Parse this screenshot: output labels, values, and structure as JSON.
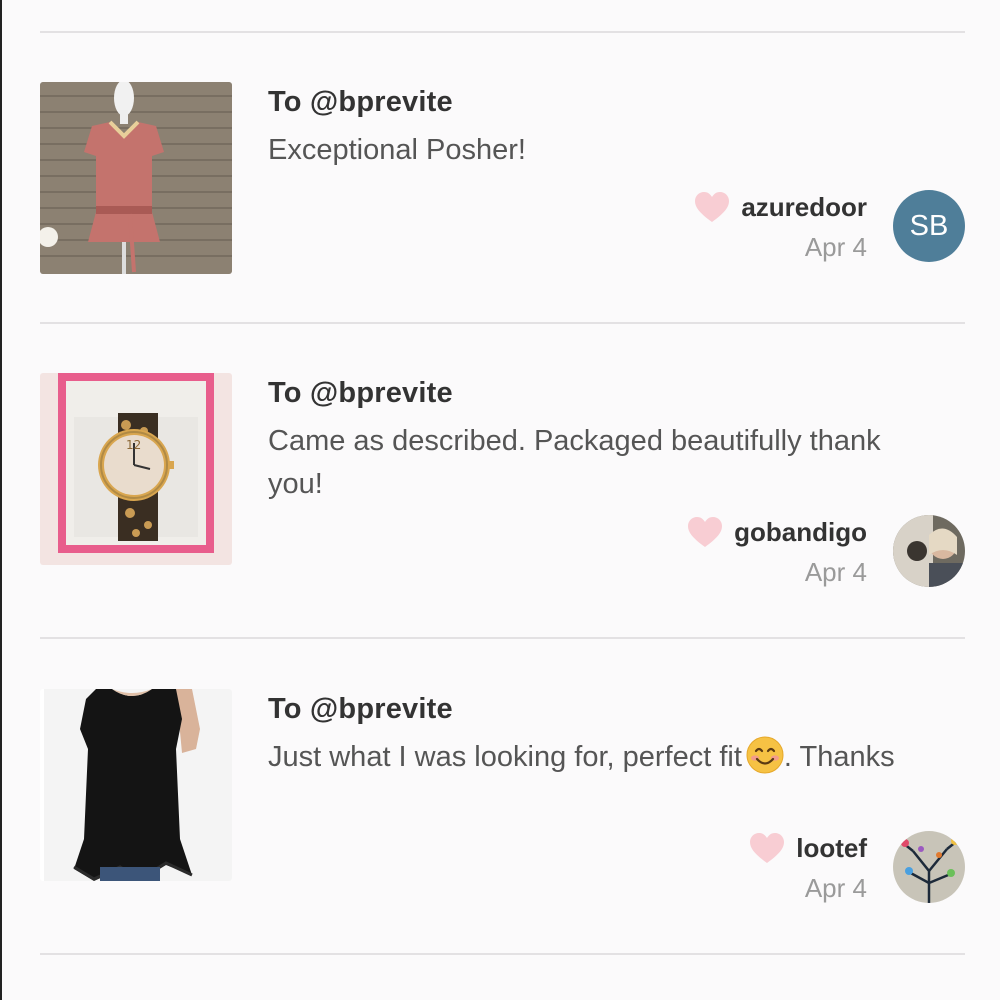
{
  "reviews": [
    {
      "to": "To @bprevite",
      "comment": "Exceptional Posher!",
      "username": "azuredoor",
      "date": "Apr 4",
      "avatar_initials": "SB",
      "item_image": "pink-blouse-on-mannequin"
    },
    {
      "to": "To @bprevite",
      "comment": "Came as described. Packaged beautifully thank you!",
      "username": "gobandigo",
      "date": "Apr 4",
      "item_image": "leopard-watch-in-pink-box"
    },
    {
      "to": "To @bprevite",
      "comment": "Just what I was looking for, perfect fit",
      "comment_suffix": ". Thanks",
      "username": "lootef",
      "date": "Apr 4",
      "item_image": "black-tunic-top"
    }
  ],
  "icons": {
    "heart": "heart-icon",
    "emoji": "smiling-face-emoji"
  },
  "colors": {
    "heart": "#f8cdd3",
    "avatar_bg": "#4f7e99",
    "divider": "#e3e1e3"
  }
}
